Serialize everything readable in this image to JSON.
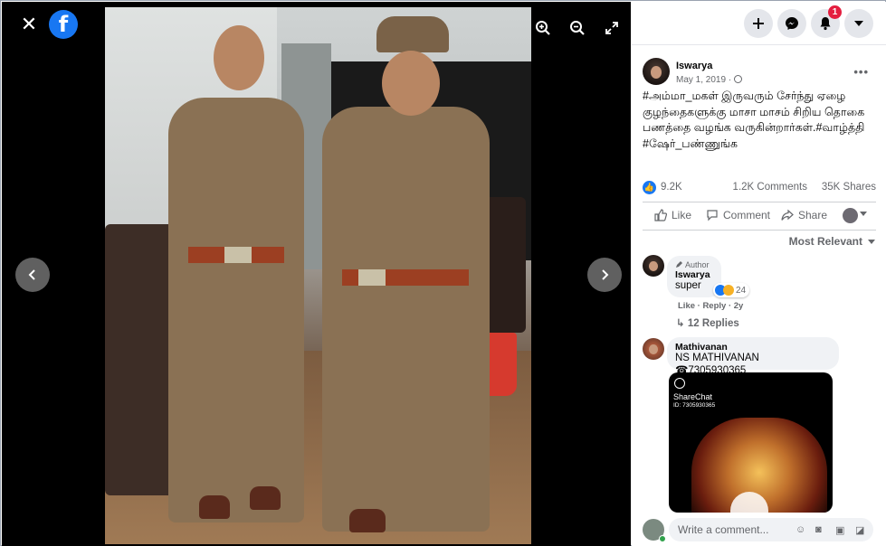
{
  "viewer": {
    "close_icon": "close-icon",
    "logo_letter": "f",
    "prev_icon": "chevron-left-icon",
    "next_icon": "chevron-right-icon",
    "photo_alt": "Two police officers in khaki uniforms standing in an office"
  },
  "topbar": {
    "notification_count": "1"
  },
  "post": {
    "author": "Iswarya",
    "date": "May 1, 2019 ·",
    "text": "#அம்மா_மகள் இருவரும் சேர்ந்து ஏழை குழந்தைகளுக்கு மாசா மாசம் சிறிய தொகை பணத்தை வழங்க வருகின்றார்கள்.#வாழ்த்தி #ஷேர்_பண்ணுங்க",
    "more_label": "•••",
    "reactions": "9.2K",
    "comments_count": "1.2K Comments",
    "shares_count": "35K Shares",
    "like_label": "Like",
    "comment_label": "Comment",
    "share_label": "Share",
    "sort_label": "Most Relevant"
  },
  "comments": [
    {
      "author_tag": "Author",
      "name": "Iswarya",
      "text": "super",
      "reaction_count": "24",
      "meta": "Like · Reply · 2y",
      "replies": "12 Replies"
    },
    {
      "name": "Mathivanan",
      "text": "NS MATHIVANAN ☎7305930365",
      "share_brand": "ShareChat",
      "share_id": "ID: 7305930365"
    }
  ],
  "composer": {
    "placeholder": "Write a comment..."
  },
  "colors": {
    "facebook_blue": "#1877f2",
    "badge_red": "#e41e3f",
    "viewer_bg": "#000000"
  }
}
